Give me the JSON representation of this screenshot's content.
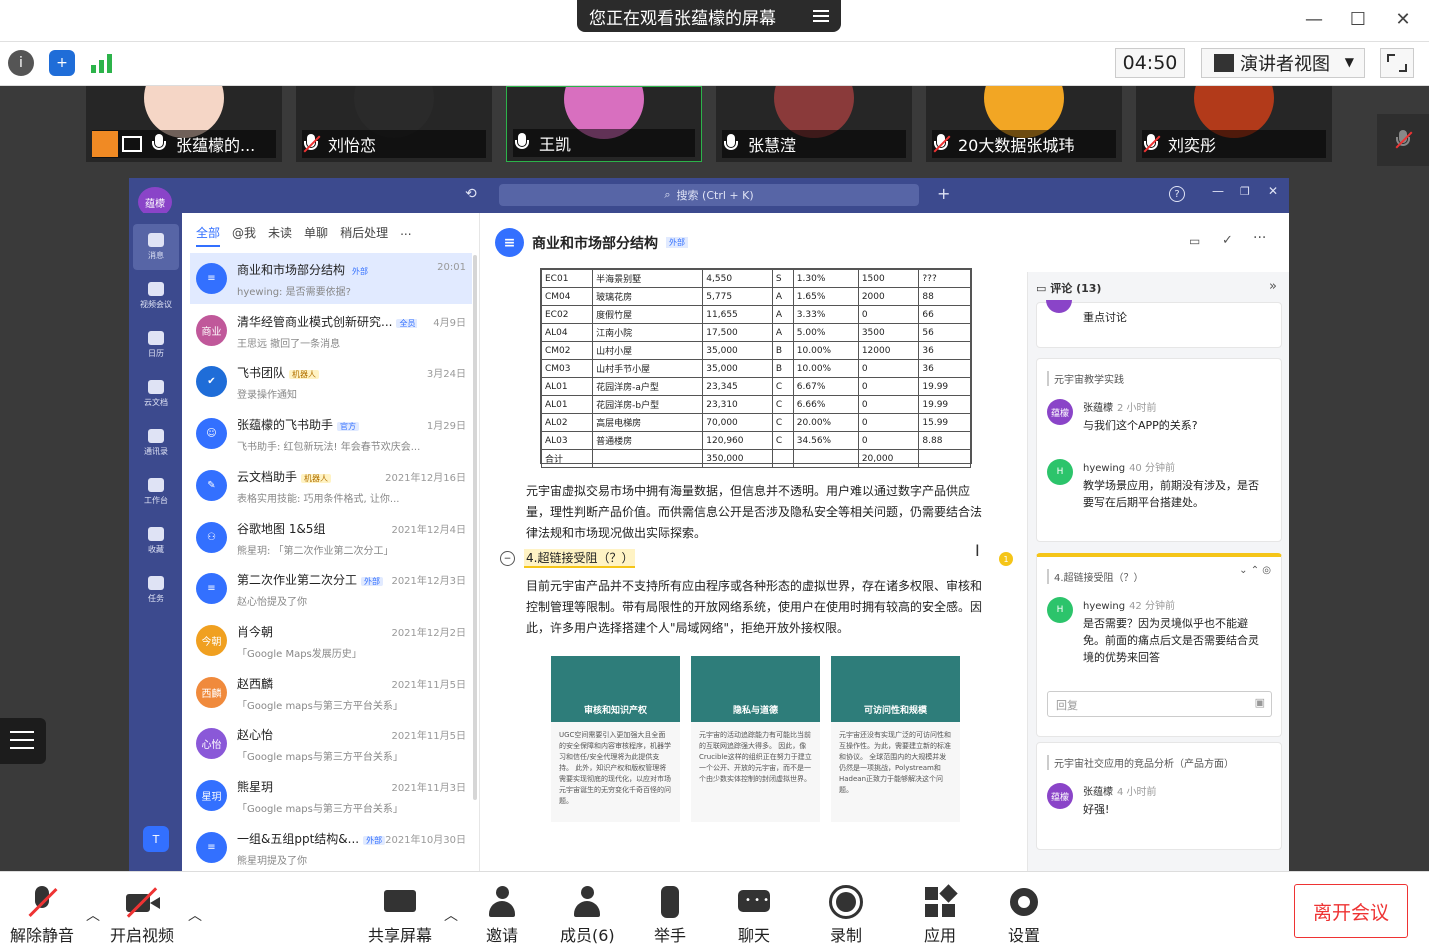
{
  "topbar": {
    "banner": "您正在观看张蕴檬的屏幕",
    "timer": "04:50",
    "view_label": "演讲者视图"
  },
  "participants": [
    {
      "name": "张蕴檬的...",
      "mic": "on",
      "color": "#f5d6c6"
    },
    {
      "name": "刘怡恋",
      "mic": "off",
      "color": "#2a2a2a"
    },
    {
      "name": "王凯",
      "mic": "on",
      "color": "#d86fbf"
    },
    {
      "name": "张慧滢",
      "mic": "on",
      "color": "#8a3a3a"
    },
    {
      "name": "20大数据张城玮",
      "mic": "off",
      "color": "#f2a624"
    },
    {
      "name": "刘奕彤",
      "mic": "off",
      "color": "#b23a1a"
    }
  ],
  "shared_app": {
    "search_placeholder": "搜索 (Ctrl + K)",
    "brand": "蕴檬",
    "nav": [
      "消息",
      "视频会议",
      "日历",
      "云文档",
      "通讯录",
      "工作台",
      "收藏",
      "任务"
    ],
    "tabs": [
      "全部",
      "@我",
      "未读",
      "单聊",
      "稍后处理",
      "..."
    ],
    "chats": [
      {
        "title": "商业和市场部分结构",
        "tag": "外部",
        "sub": "hyewing: 是否需要依据?",
        "date": "20:01",
        "color": "#3370ff",
        "av": "≡"
      },
      {
        "title": "清华经管商业模式创新研究...",
        "tag": "全员",
        "sub": "王思远 撤回了一条消息",
        "date": "4月9日",
        "color": "#c0589a",
        "av": "商业"
      },
      {
        "title": "飞书团队",
        "tag": "机器人",
        "sub": "登录操作通知",
        "date": "3月24日",
        "color": "#1f6dd8",
        "av": "✔"
      },
      {
        "title": "张蕴檬的飞书助手",
        "tag": "官方",
        "sub": "飞书助手: 红包新玩法! 年会春节欢庆会...",
        "date": "1月29日",
        "color": "#3370ff",
        "av": "☺"
      },
      {
        "title": "云文档助手",
        "tag": "机器人",
        "sub": "表格实用技能: 巧用条件格式, 让你...",
        "date": "2021年12月16日",
        "color": "#3370ff",
        "av": "✎"
      },
      {
        "title": "谷歌地图 1&5组",
        "tag": "",
        "sub": "熊星玥: 「第二次作业第二次分工」",
        "date": "2021年12月4日",
        "color": "#3370ff",
        "av": "⚇"
      },
      {
        "title": "第二次作业第二次分工",
        "tag": "外部",
        "sub": "赵心怡提及了你",
        "date": "2021年12月3日",
        "color": "#3370ff",
        "av": "≡"
      },
      {
        "title": "肖今朝",
        "tag": "",
        "sub": "「Google Maps发展历史」",
        "date": "2021年12月2日",
        "color": "#f0a020",
        "av": "今朝"
      },
      {
        "title": "赵西麟",
        "tag": "",
        "sub": "「Google maps与第三方平台关系」",
        "date": "2021年11月5日",
        "color": "#f08a3c",
        "av": "西麟"
      },
      {
        "title": "赵心怡",
        "tag": "",
        "sub": "「Google maps与第三方平台关系」",
        "date": "2021年11月5日",
        "color": "#8a58d8",
        "av": "心怡"
      },
      {
        "title": "熊星玥",
        "tag": "",
        "sub": "「Google maps与第三方平台关系」",
        "date": "2021年11月3日",
        "color": "#3370ff",
        "av": "星玥"
      },
      {
        "title": "一组&五组ppt结构&...",
        "tag": "外部",
        "sub": "熊星玥提及了你",
        "date": "2021年10月30日",
        "color": "#3370ff",
        "av": "≡"
      }
    ],
    "doc_title": "商业和市场部分结构",
    "doc_tag": "外部",
    "table": [
      [
        "EC01",
        "半海景别墅",
        "4,550",
        "S",
        "1.30%",
        "1500",
        "???"
      ],
      [
        "CM04",
        "玻璃花房",
        "5,775",
        "A",
        "1.65%",
        "2000",
        "88"
      ],
      [
        "EC02",
        "度假竹屋",
        "11,655",
        "A",
        "3.33%",
        "0",
        "66"
      ],
      [
        "AL04",
        "江南小院",
        "17,500",
        "A",
        "5.00%",
        "3500",
        "56"
      ],
      [
        "CM02",
        "山村小屋",
        "35,000",
        "B",
        "10.00%",
        "12000",
        "36"
      ],
      [
        "CM03",
        "山村手节小屋",
        "35,000",
        "B",
        "10.00%",
        "0",
        "36"
      ],
      [
        "AL01",
        "花园洋房-a户型",
        "23,345",
        "C",
        "6.67%",
        "0",
        "19.99"
      ],
      [
        "AL01",
        "花园洋房-b户型",
        "23,310",
        "C",
        "6.66%",
        "0",
        "19.99"
      ],
      [
        "AL02",
        "高层电梯房",
        "70,000",
        "C",
        "20.00%",
        "0",
        "15.99"
      ],
      [
        "AL03",
        "普通楼房",
        "120,960",
        "C",
        "34.56%",
        "0",
        "8.88"
      ],
      [
        "合计",
        "",
        "350,000",
        "",
        "",
        "20,000",
        ""
      ]
    ],
    "para1": "元宇宙虚拟交易市场中拥有海量数据，但信息并不透明。用户难以通过数字产品供应量，理性判断产品价值。而供需信息公开是否涉及隐私安全等相关问题，仍需要结合法律法规和市场现况做出实际探索。",
    "heading": "4.超链接受阻（？）",
    "para2": "目前元宇宙产品并不支持所有应由程序或各种形态的虚拟世界，存在诸多权限、审核和控制管理等限制。带有局限性的开放网络系统，使用户在使用时拥有较高的安全感。因此，许多用户选择搭建个人\"局域网络\"，拒绝开放外接权限。",
    "cards": [
      {
        "title": "审核和知识产权",
        "body": "UGC空间需要引入更加强大且全面的安全保障和内容审核程序，机器学习和信任/安全代理将为此提供支持。 此外，知识产权和版权管理将需要实现彻底的现代化，以应对市场元宇宙诞生的无穷变化千奇百怪的问题。"
      },
      {
        "title": "隐私与道德",
        "body": "元宇宙的活动追踪能力有可能比当前的互联网追踪强大得多。 因此，像Crucible这样的组织正在努力于建立一个公开、开放的元宇宙，而不是一个由少数实体控制的封闭虚拟世界。"
      },
      {
        "title": "可访问性和规模",
        "body": "元宇宙还没有实现广泛的可访问性和互操作性。为此，需要建立新的标准和协议。 全球范围内的大规模并发仍然是一项挑战，Polystream和Hadean正致力于能够解决这个问题。"
      }
    ],
    "comments": {
      "header": "评论 (13)",
      "top_text": "重点讨论",
      "threads": [
        {
          "quote": "元宇宙教学实践",
          "items": [
            {
              "author": "张蕴檬",
              "time": "2 小时前",
              "text": "与我们这个APP的关系?",
              "av": "蕴檬",
              "color": "#8a44c8"
            },
            {
              "author": "hyewing",
              "time": "40 分钟前",
              "text": "教学场景应用，前期没有涉及，是否要写在后期平台搭建处。",
              "av": "H",
              "color": "#2cc46b"
            }
          ]
        },
        {
          "quote": "4.超链接受阻（？）",
          "items": [
            {
              "author": "hyewing",
              "time": "42 分钟前",
              "text": "是否需要？因为灵境似乎也不能避免。前面的痛点后文是否需要结合灵境的优势来回答",
              "av": "H",
              "color": "#2cc46b"
            }
          ],
          "reply_placeholder": "回复"
        },
        {
          "quote": "元宇宙社交应用的竞品分析（产品方面）",
          "items": [
            {
              "author": "张蕴檬",
              "time": "4 小时前",
              "text": "好强!",
              "av": "蕴檬",
              "color": "#8a44c8"
            }
          ]
        }
      ],
      "badge": "1"
    }
  },
  "bottom": {
    "buttons": [
      "解除静音",
      "开启视频",
      "共享屏幕",
      "邀请",
      "成员(6)",
      "举手",
      "聊天",
      "录制",
      "应用",
      "设置"
    ],
    "leave": "离开会议"
  }
}
